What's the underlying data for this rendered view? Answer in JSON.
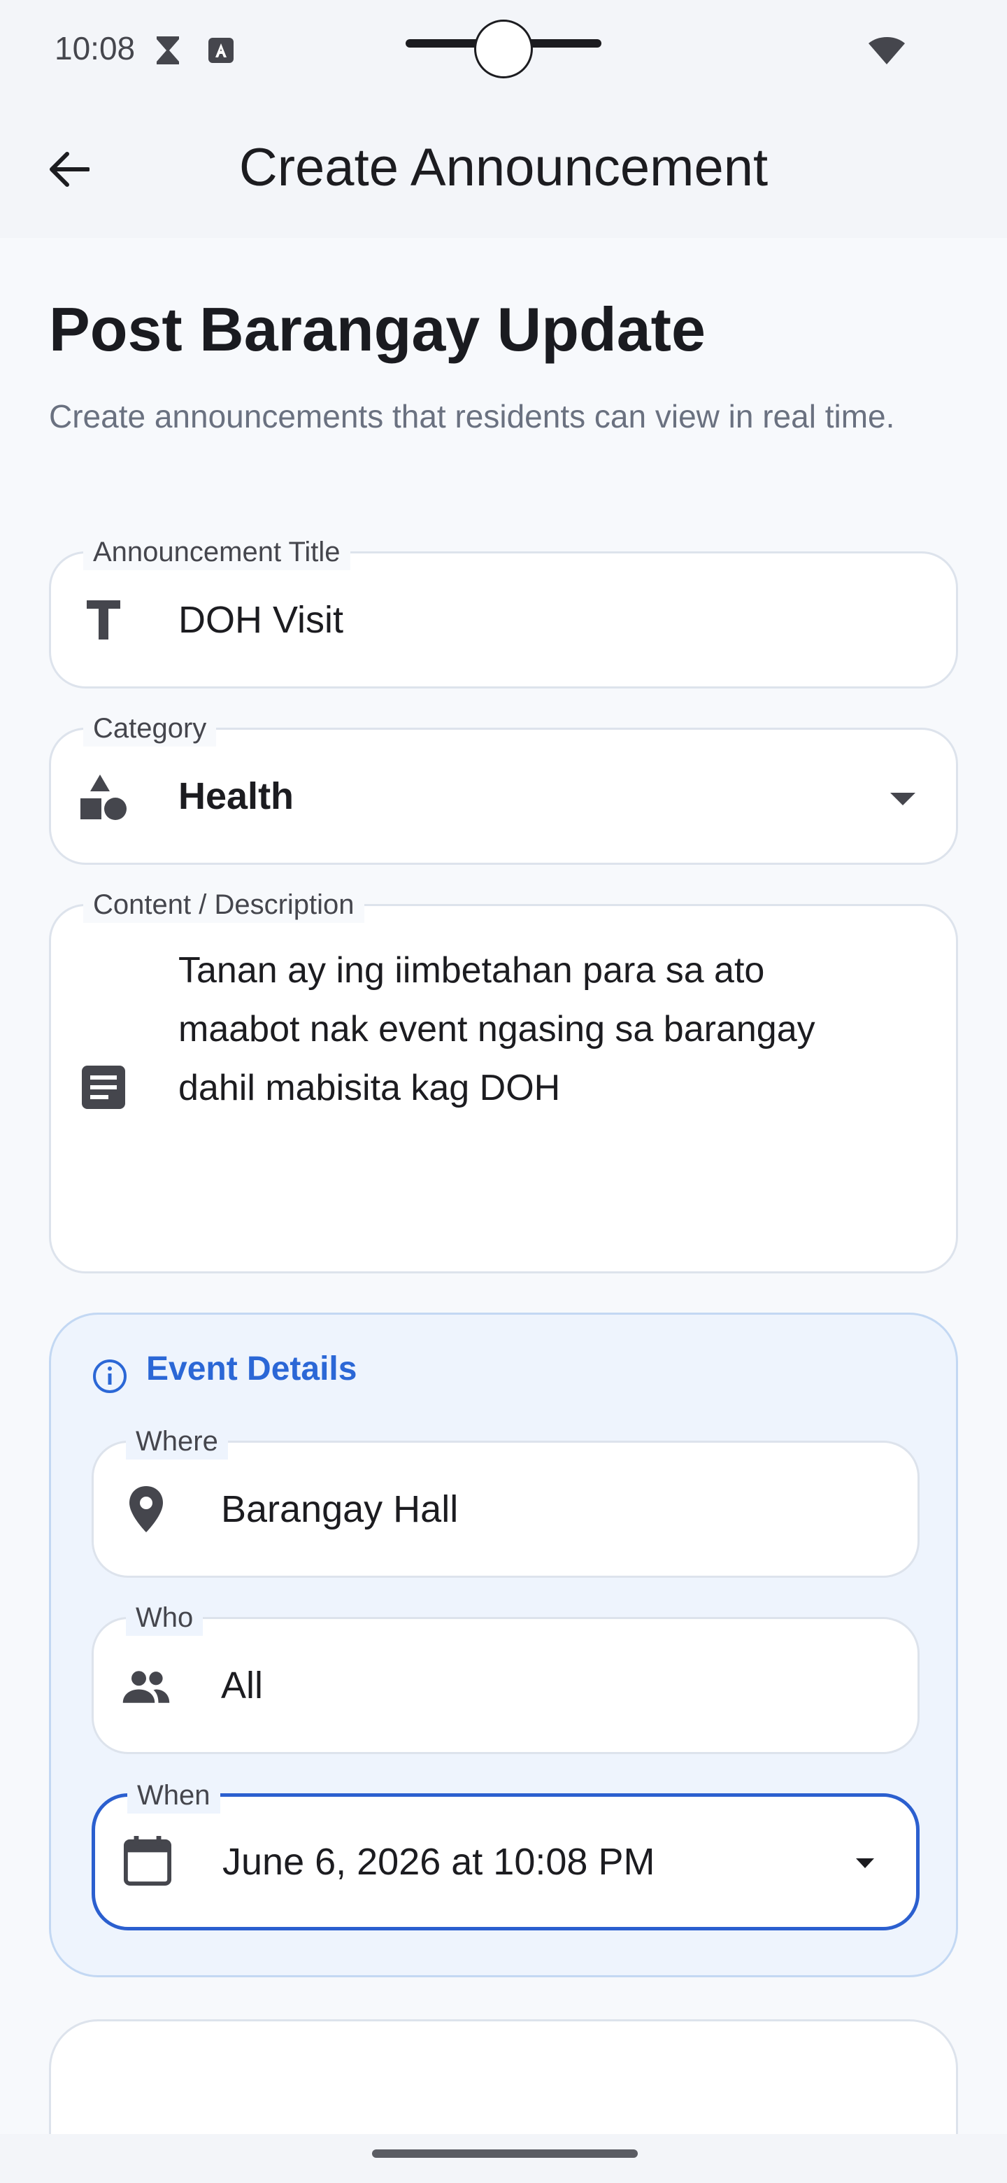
{
  "status_bar": {
    "time": "10:08"
  },
  "app_bar": {
    "title": "Create Announcement"
  },
  "page": {
    "heading": "Post Barangay Update",
    "subtitle": "Create announcements that residents can view in real time."
  },
  "form": {
    "title_field": {
      "label": "Announcement Title",
      "value": "DOH Visit",
      "icon": "title-icon"
    },
    "category_field": {
      "label": "Category",
      "value": "Health",
      "icon": "category-icon"
    },
    "content_field": {
      "label": "Content / Description",
      "value_lines": [
        "Tanan ay ing iimbetahan para sa ato",
        "maabot nak event ngasing sa barangay",
        "dahil mabisita kag DOH"
      ],
      "icon": "description-icon"
    }
  },
  "event_details": {
    "title": "Event Details",
    "where": {
      "label": "Where",
      "value": "Barangay Hall",
      "icon": "location-pin-icon"
    },
    "who": {
      "label": "Who",
      "value": "All",
      "icon": "people-icon"
    },
    "when": {
      "label": "When",
      "value": "June 6, 2026 at 10:08 PM",
      "icon": "calendar-icon"
    }
  },
  "colors": {
    "accent": "#2b67d6",
    "focus_border": "#2b5fcf",
    "card_bg": "#eef4fd"
  }
}
